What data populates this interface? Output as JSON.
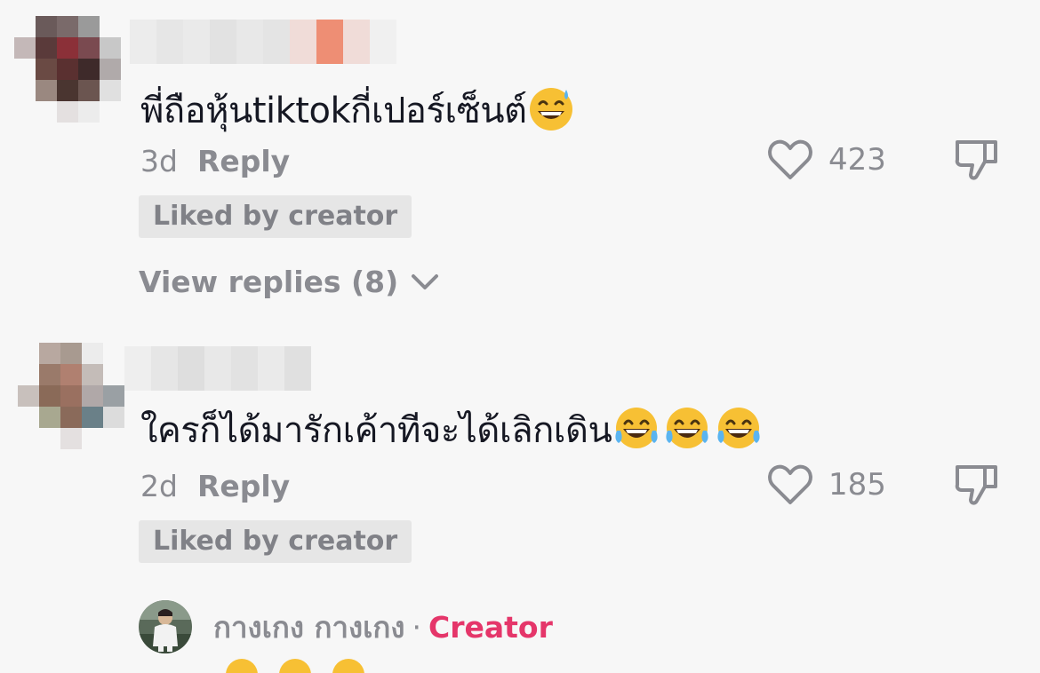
{
  "comments": [
    {
      "text": "พี่ถือหุ้นtiktokกี่เปอร์เซ็นต์",
      "emoji": "sweat-smile-emoji",
      "age": "3d",
      "reply_label": "Reply",
      "likes": "423",
      "liked_badge": "Liked by creator",
      "view_replies": "View replies (8)"
    },
    {
      "text": "ใครก็ได้มารักเค้าทีจะได้เลิกเดิน",
      "emoji": "tears-of-joy-emoji",
      "emoji_count": 3,
      "age": "2d",
      "reply_label": "Reply",
      "likes": "185",
      "liked_badge": "Liked by creator"
    }
  ],
  "creator_reply": {
    "name": "กางเกง กางเกง",
    "separator": "·",
    "tag": "Creator"
  },
  "icons": {
    "like": "heart-outline-icon",
    "dislike": "thumbs-down-outline-icon",
    "expand": "chevron-down-icon"
  },
  "colors": {
    "background": "#f7f7f7",
    "text": "#161823",
    "muted": "#8a8b91",
    "badge_bg": "#e6e6e6",
    "creator_accent": "#e5366a"
  }
}
